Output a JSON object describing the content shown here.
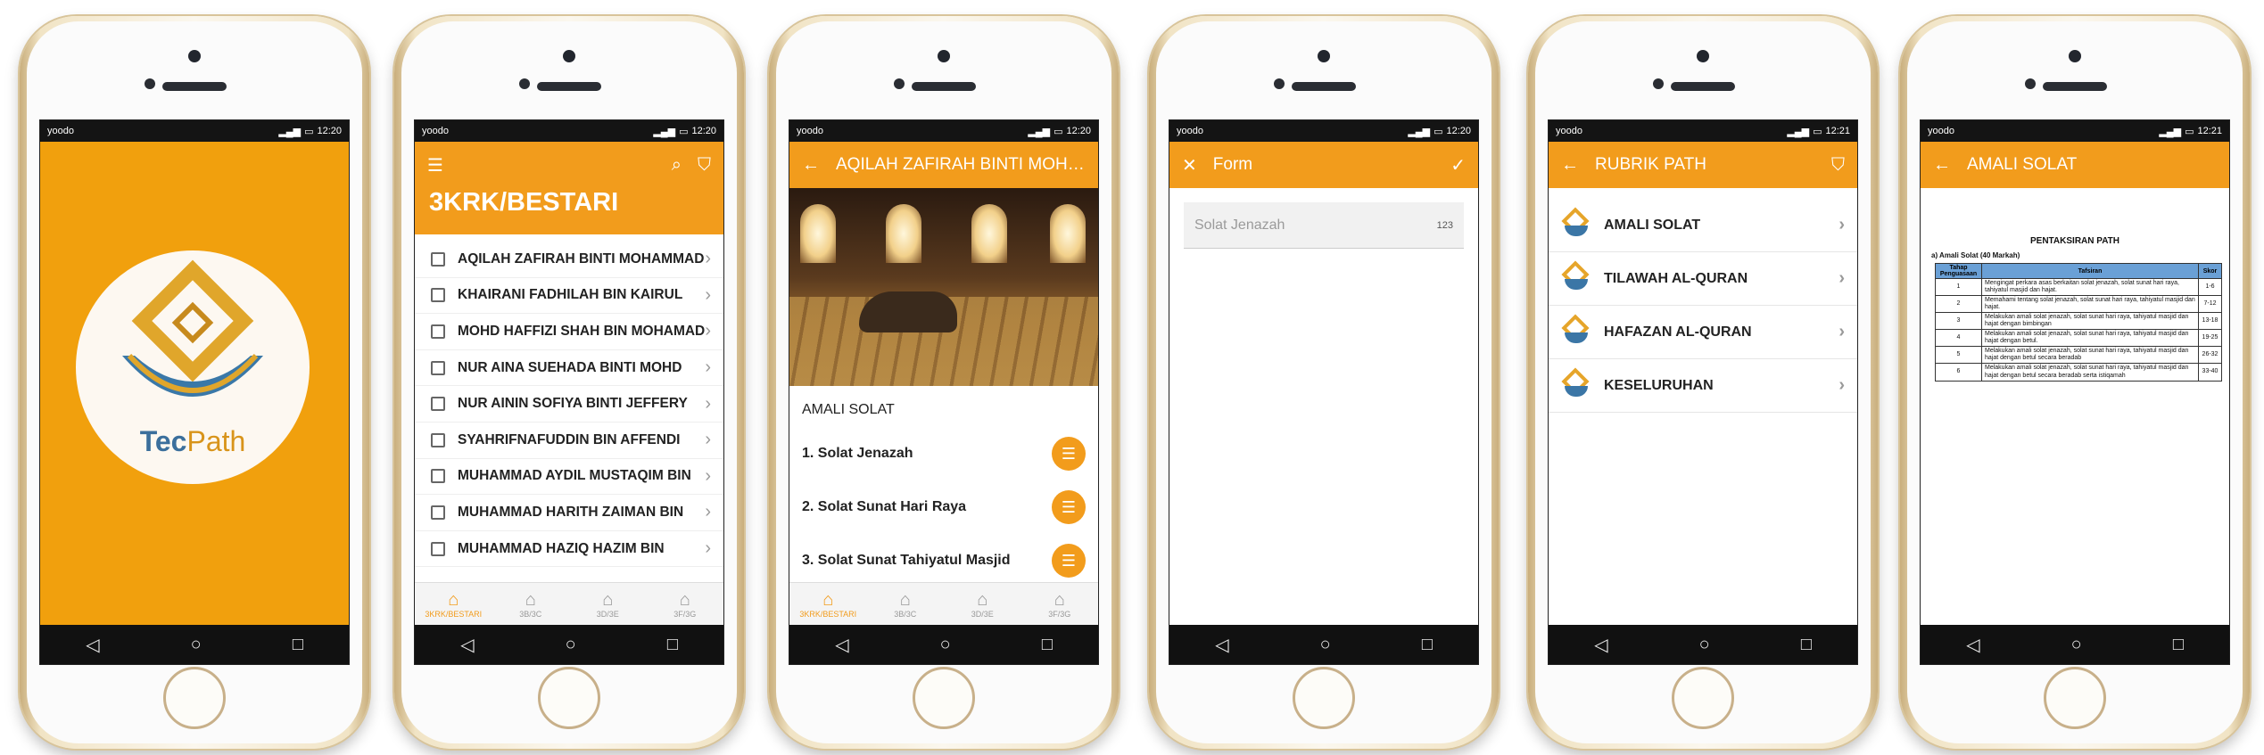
{
  "status": {
    "carrier": "yoodo",
    "time1": "12:20",
    "time2": "12:21"
  },
  "splash": {
    "brand_tec": "Tec",
    "brand_path": "Path"
  },
  "class_list": {
    "title": "3KRK/BESTARI",
    "students": [
      "AQILAH ZAFIRAH BINTI MOHAMMAD",
      "KHAIRANI FADHILAH BIN KAIRUL",
      "MOHD HAFFIZI SHAH BIN MOHAMAD",
      "NUR AINA SUEHADA BINTI MOHD",
      "NUR AININ SOFIYA BINTI JEFFERY",
      "SYAHRIFNAFUDDIN BIN AFFENDI",
      "MUHAMMAD AYDIL MUSTAQIM BIN",
      "MUHAMMAD HARITH ZAIMAN BIN",
      "MUHAMMAD HAZIQ HAZIM BIN"
    ],
    "tabs": [
      "3KRK/BESTARI",
      "3B/3C",
      "3D/3E",
      "3F/3G"
    ]
  },
  "detail": {
    "title": "AQILAH ZAFIRAH BINTI MOHAMMAD",
    "section": "AMALI SOLAT",
    "steps": [
      "1. Solat Jenazah",
      "2. Solat Sunat Hari Raya",
      "3. Solat Sunat Tahiyatul Masjid"
    ]
  },
  "form": {
    "title": "Form",
    "field_value": "Solat Jenazah",
    "field_counter": "123"
  },
  "rubrik": {
    "title": "RUBRIK PATH",
    "items": [
      "AMALI SOLAT",
      "TILAWAH AL-QURAN",
      "HAFAZAN AL-QURAN",
      "KESELURUHAN"
    ],
    "icon_caption": "TecPath"
  },
  "amali": {
    "title": "AMALI SOLAT",
    "doc_heading": "PENTAKSIRAN PATH",
    "doc_sub": "a)  Amali Solat (40 Markah)",
    "col_headers": [
      "Tahap Penguasaan",
      "Tafsiran",
      "Skor"
    ],
    "rows": [
      {
        "level": "1",
        "desc": "Mengingat perkara asas berkaitan solat jenazah, solat sunat hari raya, tahiyatul masjid dan hajat.",
        "score": "1-6"
      },
      {
        "level": "2",
        "desc": "Memahami tentang solat jenazah, solat sunat hari raya, tahiyatul masjid dan hajat.",
        "score": "7-12"
      },
      {
        "level": "3",
        "desc": "Melakukan amali solat jenazah, solat sunat hari raya, tahiyatul masjid dan hajat dengan bimbingan",
        "score": "13-18"
      },
      {
        "level": "4",
        "desc": "Melakukan amali solat jenazah, solat sunat hari raya, tahiyatul masjid dan hajat dengan betul.",
        "score": "19-25"
      },
      {
        "level": "5",
        "desc": "Melakukan amali solat jenazah, solat sunat hari raya, tahiyatul masjid dan hajat dengan betul secara beradab",
        "score": "26-32"
      },
      {
        "level": "6",
        "desc": "Melakukan amali solat jenazah, solat sunat hari raya, tahiyatul masjid dan hajat dengan betul secara beradab serta istiqamah",
        "score": "33-40"
      }
    ]
  },
  "colors": {
    "accent": "#f29c1c",
    "splash_bg": "#f1a00d",
    "header_blue": "#6aa0d6"
  }
}
